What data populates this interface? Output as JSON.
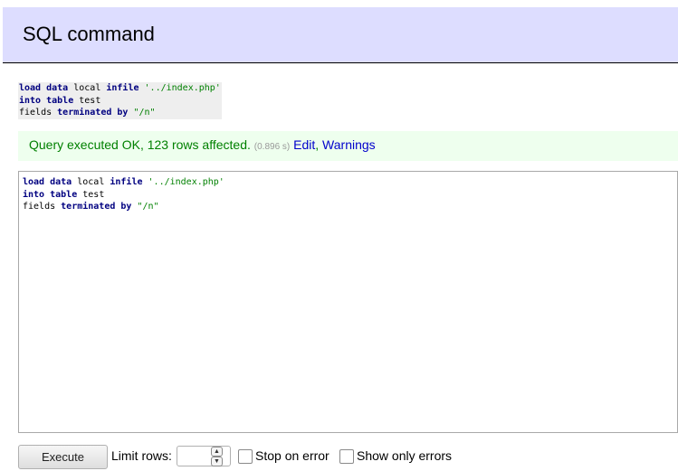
{
  "page": {
    "title": "SQL command"
  },
  "executed_query": {
    "lines": [
      [
        {
          "t": "load",
          "k": "kw"
        },
        {
          "t": " ",
          "k": ""
        },
        {
          "t": "data",
          "k": "kw"
        },
        {
          "t": " local ",
          "k": ""
        },
        {
          "t": "infile",
          "k": "kw"
        },
        {
          "t": " ",
          "k": ""
        },
        {
          "t": "'../index.php'",
          "k": "str"
        }
      ],
      [
        {
          "t": "into",
          "k": "kw"
        },
        {
          "t": " ",
          "k": ""
        },
        {
          "t": "table",
          "k": "kw"
        },
        {
          "t": " test",
          "k": ""
        }
      ],
      [
        {
          "t": "fields ",
          "k": ""
        },
        {
          "t": "terminated",
          "k": "kw"
        },
        {
          "t": " ",
          "k": ""
        },
        {
          "t": "by",
          "k": "kw"
        },
        {
          "t": " ",
          "k": ""
        },
        {
          "t": "\"/n\"",
          "k": "str"
        }
      ]
    ]
  },
  "message": {
    "text": "Query executed OK, 123 rows affected.",
    "time": "(0.896 s)",
    "edit_link": "Edit",
    "separator": ",",
    "warnings_link": "Warnings"
  },
  "editor": {
    "lines": [
      [
        {
          "t": "load",
          "k": "kw"
        },
        {
          "t": " ",
          "k": ""
        },
        {
          "t": "data",
          "k": "kw"
        },
        {
          "t": " local ",
          "k": ""
        },
        {
          "t": "infile",
          "k": "kw"
        },
        {
          "t": " ",
          "k": ""
        },
        {
          "t": "'../index.php'",
          "k": "str"
        }
      ],
      [
        {
          "t": "into",
          "k": "kw"
        },
        {
          "t": " ",
          "k": ""
        },
        {
          "t": "table",
          "k": "kw"
        },
        {
          "t": " test",
          "k": ""
        }
      ],
      [
        {
          "t": "fields ",
          "k": ""
        },
        {
          "t": "terminated",
          "k": "kw"
        },
        {
          "t": " ",
          "k": ""
        },
        {
          "t": "by",
          "k": "kw"
        },
        {
          "t": " ",
          "k": ""
        },
        {
          "t": "\"/n\"",
          "k": "str"
        }
      ]
    ]
  },
  "controls": {
    "execute_label": "Execute",
    "limit_rows_label": "Limit rows:",
    "limit_rows_value": "",
    "stop_on_error_label": "Stop on error",
    "stop_on_error_checked": false,
    "show_only_errors_label": "Show only errors",
    "show_only_errors_checked": false
  },
  "icons": {
    "spin_up": "chevron-up-icon",
    "spin_down": "chevron-down-icon"
  },
  "colors": {
    "header_bg": "#ddddff",
    "message_bg": "#eeffee",
    "message_text": "#008000",
    "link": "#0000cc",
    "keyword": "#000080",
    "string": "#008000"
  }
}
